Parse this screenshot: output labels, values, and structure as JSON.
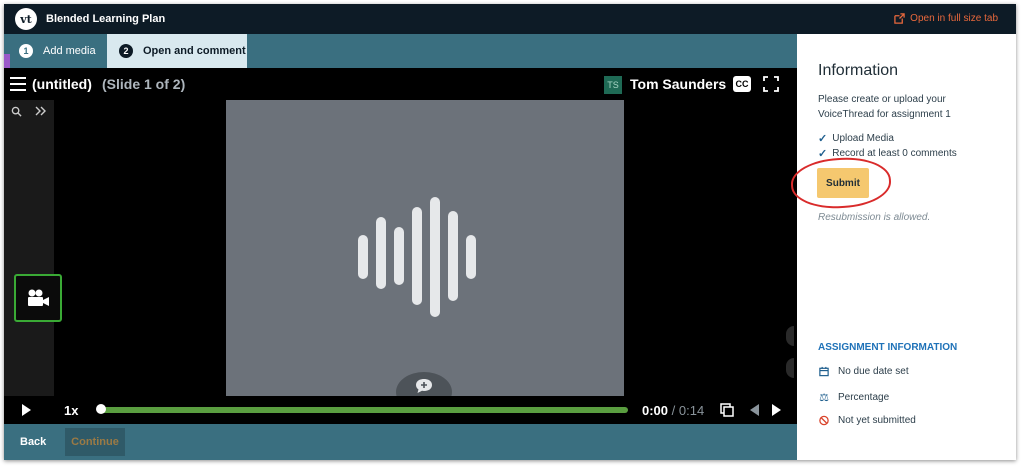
{
  "app": {
    "logo_text": "vt",
    "title": "Blended Learning Plan",
    "open_full_label": "Open in full size tab"
  },
  "tabs": [
    {
      "number": "1",
      "label": "Add media"
    },
    {
      "number": "2",
      "label": "Open and comment"
    }
  ],
  "player": {
    "title": "(untitled)",
    "slide_indicator": "(Slide 1 of 2)",
    "user_initials": "TS",
    "user_name": "Tom Saunders",
    "cc_label": "CC",
    "speed": "1x",
    "time_current": "0:00",
    "time_separator": " / ",
    "time_total": "0:14",
    "progress_fraction": 0
  },
  "footer": {
    "back_label": "Back",
    "continue_label": "Continue"
  },
  "info": {
    "title": "Information",
    "instruction": "Please create or upload your VoiceThread for assignment 1",
    "checklist": [
      "Upload Media",
      "Record at least 0 comments"
    ],
    "submit_label": "Submit",
    "resubmission": "Resubmission is allowed.",
    "assignment_heading": "ASSIGNMENT INFORMATION",
    "due": "No due date set",
    "grading": "Percentage",
    "status": "Not yet submitted"
  },
  "colors": {
    "accent_teal": "#3a6f80",
    "submit": "#f5c86f",
    "progress": "#5a9e40",
    "link_orange": "#e8683c",
    "annotation_red": "#d92b2b"
  },
  "icons": {
    "open_full": "external-link-icon",
    "menu": "hamburger-menu-icon",
    "search": "search-icon",
    "expand": "double-chevron-right-icon",
    "camera": "video-camera-icon",
    "audio": "audio-waveform-icon",
    "comment": "add-comment-icon",
    "fullscreen": "fullscreen-icon",
    "copy": "copy-icon",
    "calendar": "calendar-icon",
    "scale": "balance-scale-icon",
    "status": "prohibited-icon"
  }
}
